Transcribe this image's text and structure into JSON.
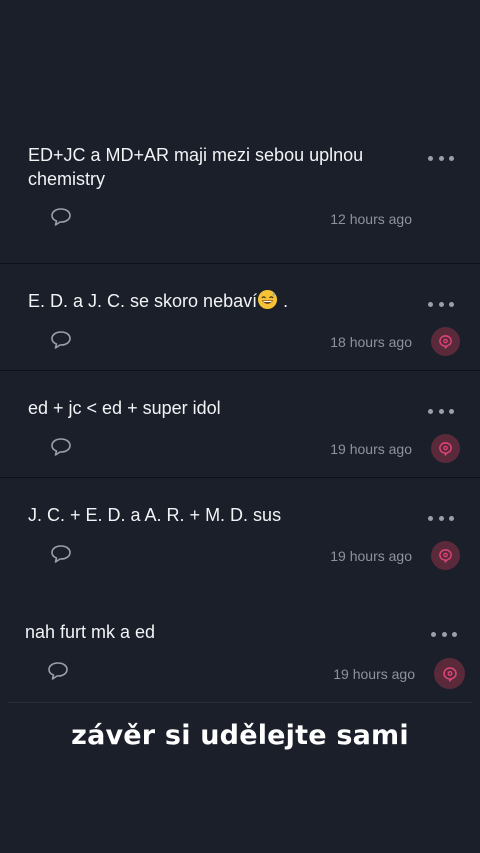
{
  "posts": [
    {
      "text": "ED+JC a MD+AR maji mezi sebou uplnou chemistry",
      "time": "12 hours ago",
      "has_reaction": false
    },
    {
      "text": "E. D. a J. C. se skoro nebaví",
      "text_suffix": ".",
      "time": "18 hours ago",
      "has_reaction": true
    },
    {
      "text": "ed + jc < ed + super idol",
      "time": "19 hours ago",
      "has_reaction": true
    },
    {
      "text": "J. C. + E. D. a A. R. + M. D. sus",
      "time": "19 hours ago",
      "has_reaction": true
    },
    {
      "text": "nah furt mk a ed",
      "time": "19 hours ago",
      "has_reaction": true
    }
  ],
  "caption": "závěr si udělejte sami",
  "icons": {
    "more": "more-horizontal-icon",
    "comment": "comment-bubble-icon",
    "reaction": "pink-reaction-icon",
    "emoji": "grinning-sweat-emoji"
  },
  "colors": {
    "background": "#1b1f2a",
    "reaction_bg": "#5a2a3b",
    "reaction_fg": "#e0457a",
    "muted": "#8d929c"
  }
}
